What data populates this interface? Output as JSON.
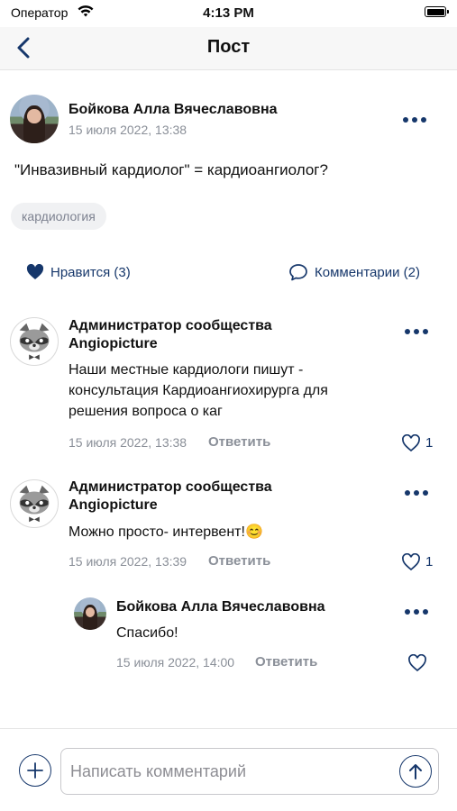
{
  "status_bar": {
    "carrier": "Оператор",
    "time": "4:13 PM"
  },
  "nav": {
    "title": "Пост"
  },
  "post": {
    "author": "Бойкова Алла Вячеславовна",
    "date": "15 июля 2022, 13:38",
    "text": "\"Инвазивный кардиолог\" = кардиоангиолог?",
    "tag": "кардиология",
    "likes_label": "Нравится (3)",
    "comments_label": "Комментарии (2)"
  },
  "comments": [
    {
      "author_line1": "Администратор сообщества",
      "author_line2": "Angiopicture",
      "text_line1": "Наши местные кардиологи пишут -",
      "text_line2": "консультация Кардиоангиохирурга для",
      "text_line3": "решения вопроса о каг",
      "date": "15 июля 2022, 13:38",
      "reply_label": "Ответить",
      "likes": "1"
    },
    {
      "author_line1": "Администратор сообщества",
      "author_line2": "Angiopicture",
      "text": "Можно просто- интервент!😊",
      "date": "15 июля 2022, 13:39",
      "reply_label": "Ответить",
      "likes": "1"
    },
    {
      "author": "Бойкова Алла Вячеславовна",
      "text": "Спасибо!",
      "date": "15 июля 2022, 14:00",
      "reply_label": "Ответить"
    }
  ],
  "composer": {
    "placeholder": "Написать комментарий"
  },
  "colors": {
    "accent": "#16376b",
    "muted": "#8a8f98",
    "tag_bg": "#f0f1f3"
  }
}
